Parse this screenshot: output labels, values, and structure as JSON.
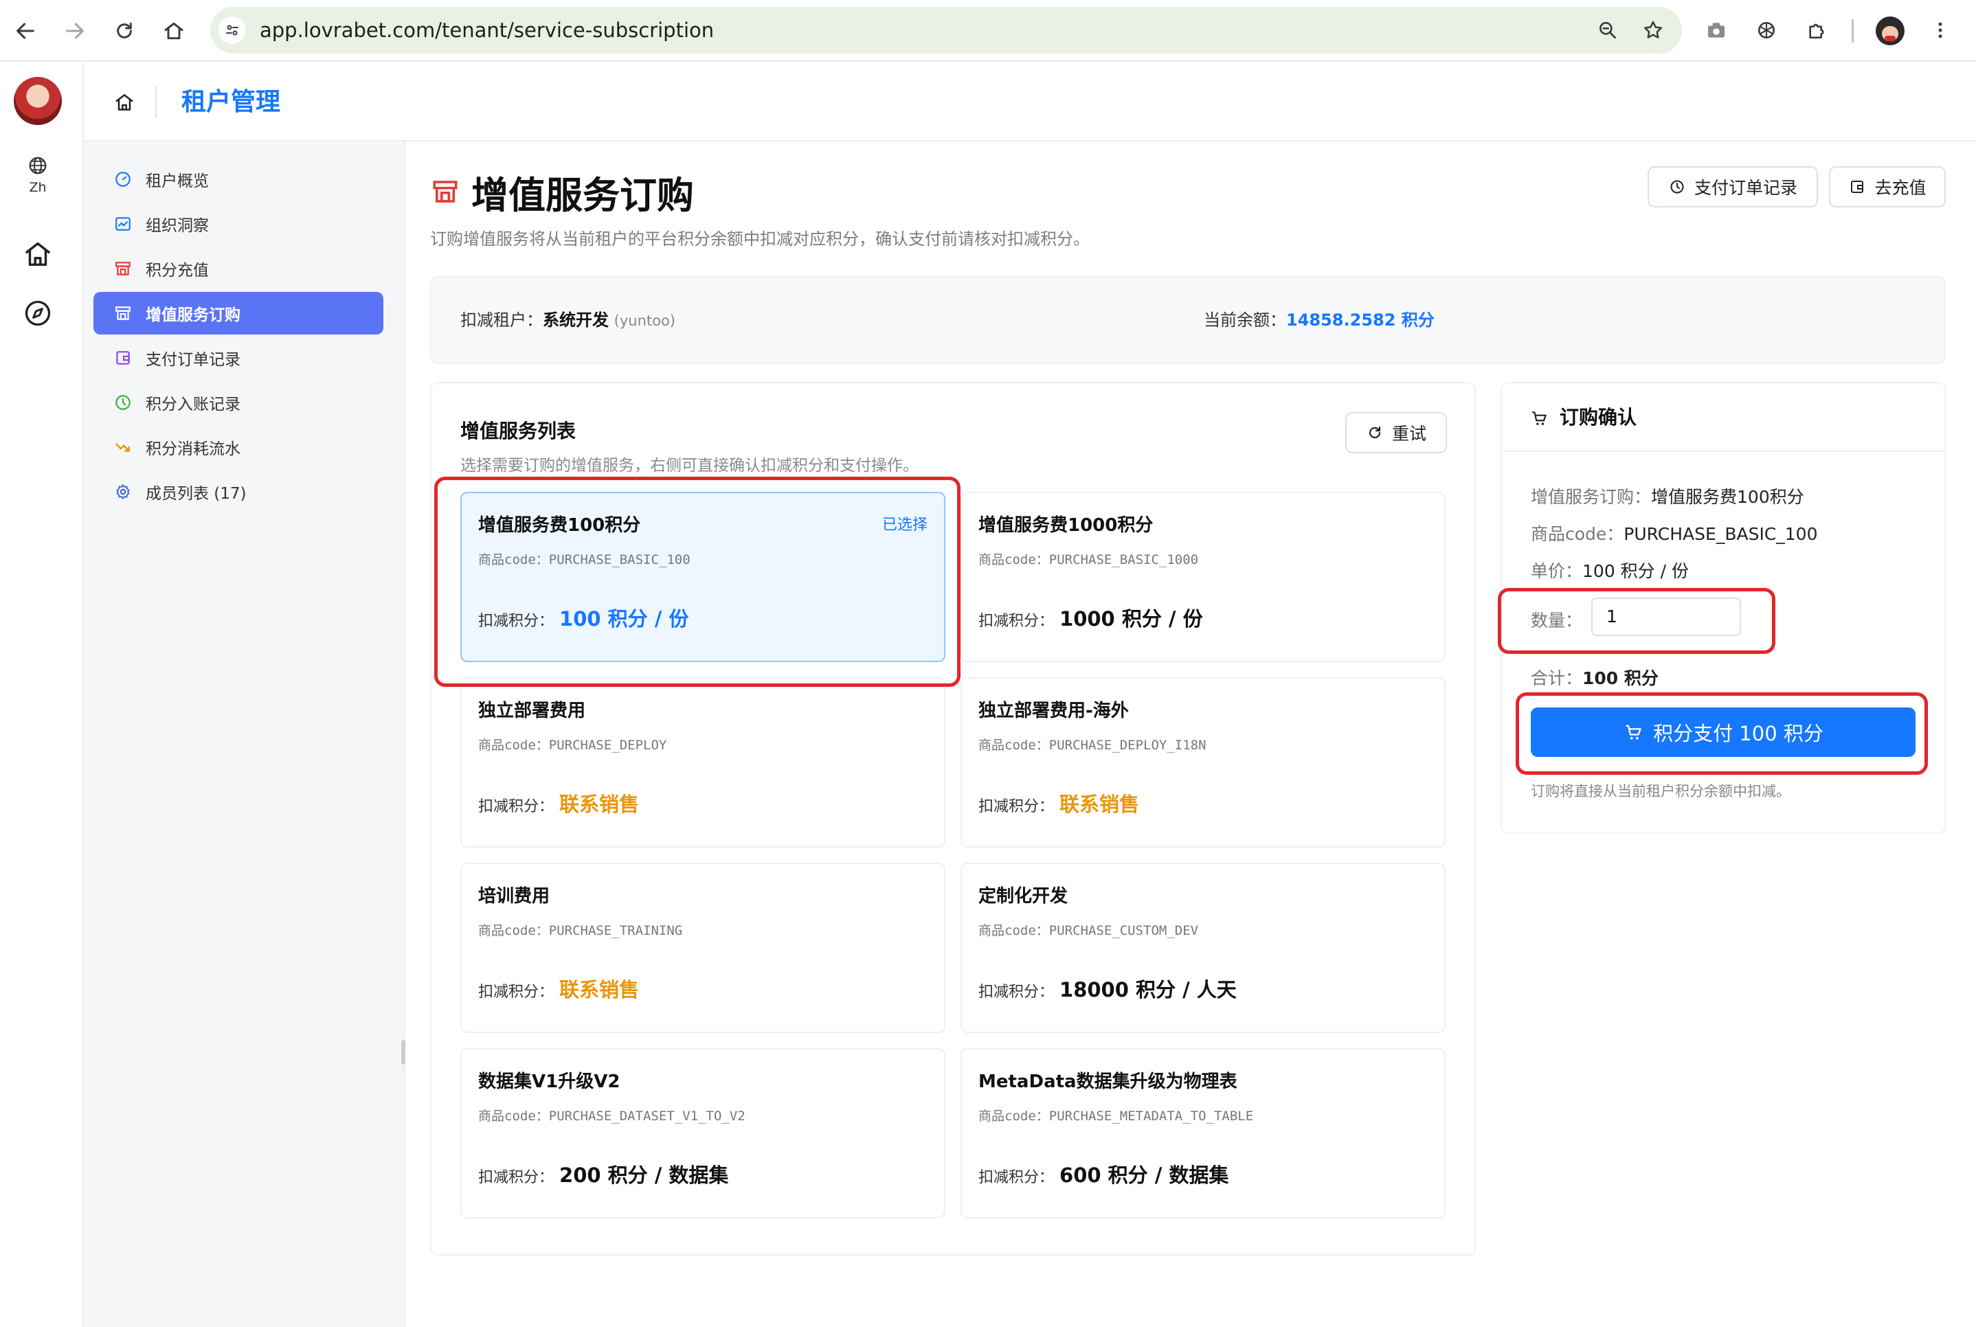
{
  "browser": {
    "url": "app.lovrabet.com/tenant/service-subscription"
  },
  "rail": {
    "lang_label": "Zh"
  },
  "header": {
    "title": "租户管理"
  },
  "menu": {
    "items": [
      {
        "label": "租户概览",
        "icon": "gauge-icon",
        "active": false
      },
      {
        "label": "组织洞察",
        "icon": "line-chart-icon",
        "active": false
      },
      {
        "label": "积分充值",
        "icon": "shop-icon",
        "active": false
      },
      {
        "label": "增值服务订购",
        "icon": "shop-icon",
        "active": true
      },
      {
        "label": "支付订单记录",
        "icon": "wallet-icon",
        "active": false
      },
      {
        "label": "积分入账记录",
        "icon": "clock-icon",
        "active": false
      },
      {
        "label": "积分消耗流水",
        "icon": "fall-chart-icon",
        "active": false
      },
      {
        "label": "成员列表 (17)",
        "icon": "gear-icon",
        "active": false
      }
    ]
  },
  "page": {
    "title": "增值服务订购",
    "description": "订购增值服务将从当前租户的平台积分余额中扣减对应积分，确认支付前请核对扣减积分。",
    "orders_button": "支付订单记录",
    "recharge_button": "去充值"
  },
  "tenant": {
    "label": "扣减租户：",
    "name": "系统开发",
    "code": "(yuntoo)",
    "balance_label": "当前余额：",
    "balance": "14858.2582 积分"
  },
  "services": {
    "title": "增值服务列表",
    "subtitle": "选择需要订购的增值服务，右侧可直接确认扣减积分和支付操作。",
    "retry_button": "重试",
    "price_label": "扣减积分：",
    "selected_tag": "已选择",
    "items": [
      {
        "name": "增值服务费100积分",
        "code": "商品code：PURCHASE_BASIC_100",
        "price": "100 积分 / 份",
        "style": "blue"
      },
      {
        "name": "增值服务费1000积分",
        "code": "商品code：PURCHASE_BASIC_1000",
        "price": "1000 积分 / 份",
        "style": "dark"
      },
      {
        "name": "独立部署费用",
        "code": "商品code：PURCHASE_DEPLOY",
        "price": "联系销售",
        "style": "orange"
      },
      {
        "name": "独立部署费用-海外",
        "code": "商品code：PURCHASE_DEPLOY_I18N",
        "price": "联系销售",
        "style": "orange"
      },
      {
        "name": "培训费用",
        "code": "商品code：PURCHASE_TRAINING",
        "price": "联系销售",
        "style": "orange"
      },
      {
        "name": "定制化开发",
        "code": "商品code：PURCHASE_CUSTOM_DEV",
        "price": "18000 积分 / 人天",
        "style": "dark"
      },
      {
        "name": "数据集V1升级V2",
        "code": "商品code：PURCHASE_DATASET_V1_TO_V2",
        "price": "200 积分 / 数据集",
        "style": "dark"
      },
      {
        "name": "MetaData数据集升级为物理表",
        "code": "商品code：PURCHASE_METADATA_TO_TABLE",
        "price": "600 积分 / 数据集",
        "style": "dark"
      }
    ]
  },
  "confirm": {
    "title": "订购确认",
    "service_key": "增值服务订购：",
    "service_value": "增值服务费100积分",
    "code_key": "商品code：",
    "code_value": "PURCHASE_BASIC_100",
    "unit_key": "单价：",
    "unit_value": "100 积分 / 份",
    "qty_key": "数量：",
    "qty_value": "1",
    "total_key": "合计：",
    "total_value": "100 积分",
    "pay_button": "积分支付 100 积分",
    "hint": "订购将直接从当前租户积分余额中扣减。"
  },
  "colors": {
    "accent": "#1677ff",
    "menu_active": "#5b74f5",
    "contact_sales": "#e8960c",
    "highlight_box": "#e3262b"
  }
}
